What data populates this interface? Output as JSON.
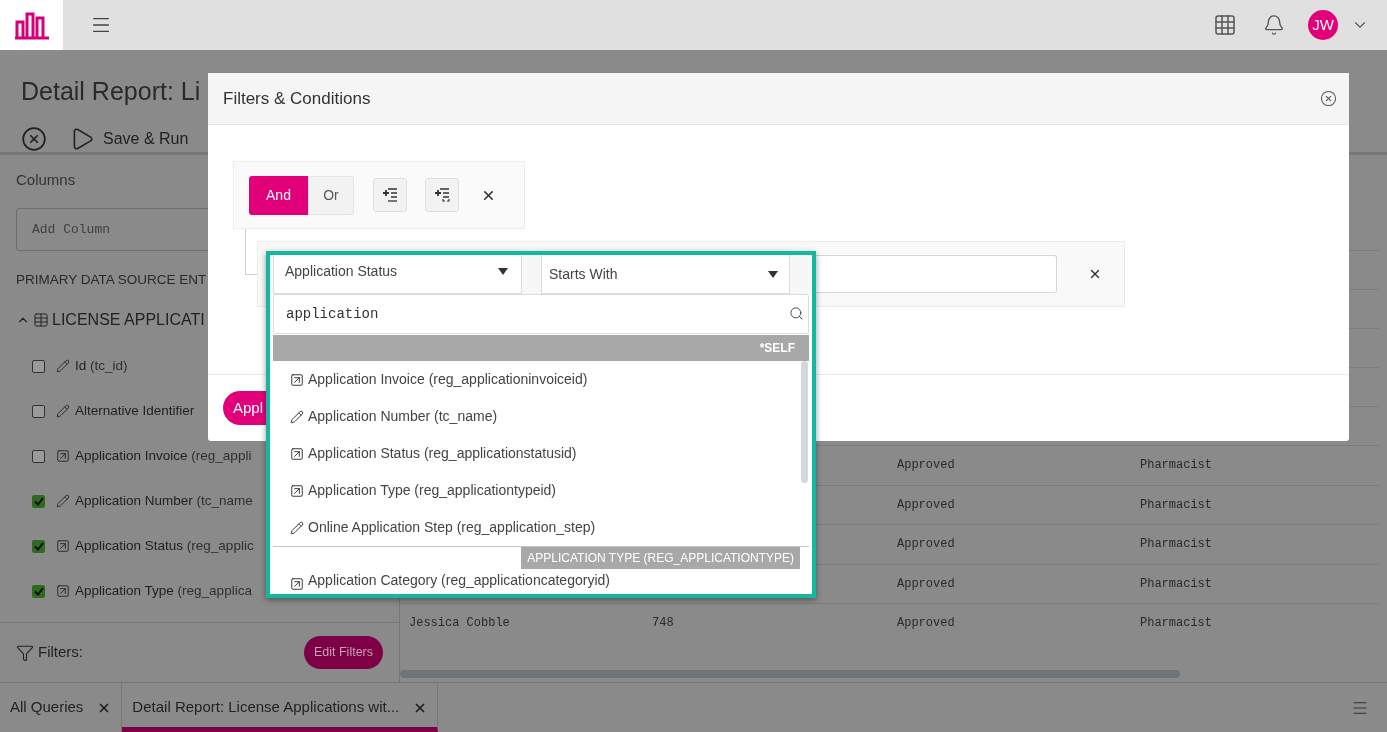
{
  "top_bar": {
    "avatar_initials": "JW"
  },
  "page": {
    "title": "Detail Report: Li",
    "run_label": "Save & Run"
  },
  "columns_panel": {
    "heading": "Columns",
    "add_column": {
      "placeholder": "Add Column"
    },
    "section_label": "PRIMARY DATA SOURCE ENT",
    "entity": {
      "label": "LICENSE APPLICATI",
      "expanded": true
    },
    "fields": [
      {
        "kind": "edit",
        "name": "Id",
        "attr": "(tc_id)",
        "checked": false
      },
      {
        "kind": "edit",
        "name": "Alternative Identifier",
        "checked": false
      },
      {
        "kind": "link",
        "name": "Application Invoice",
        "attr": "(reg_appli",
        "checked": false
      },
      {
        "kind": "edit",
        "name": "Application Number",
        "attr": "(tc_name",
        "checked": true
      },
      {
        "kind": "link",
        "name": "Application Status",
        "attr": "(reg_applic",
        "checked": true
      },
      {
        "kind": "link",
        "name": "Application Type",
        "attr": "(reg_applica",
        "checked": true
      }
    ]
  },
  "filters_bar": {
    "label": "Filters:",
    "button": "Edit Filters"
  },
  "table": {
    "rows": [
      {
        "status": "Approved",
        "role": "Pharmacist"
      },
      {
        "status": "Approved",
        "role": "Pharmacist"
      },
      {
        "status": "Approved",
        "role": "Pharmacist"
      },
      {
        "status": "Approved",
        "role": "Pharmacist"
      },
      {
        "name": "Jessica Cobble",
        "number": "748",
        "status": "Approved",
        "role": "Pharmacist"
      }
    ]
  },
  "bottom_tabs": [
    {
      "label": "All Queries",
      "selected": false
    },
    {
      "label": "Detail Report: License Applications wit...",
      "selected": true
    }
  ],
  "dialog": {
    "title": "Filters & Conditions",
    "operators": [
      {
        "label": "And",
        "selected": true
      },
      {
        "label": "Or",
        "selected": false
      }
    ],
    "condition": {
      "field": "Application Status",
      "operator": "Starts With"
    },
    "apply_label": "Appl"
  },
  "field_picker": {
    "search_value": "application",
    "groups": [
      {
        "header": "*SELF",
        "items": [
          {
            "kind": "link",
            "label": "Application Invoice (reg_applicationinvoiceid)"
          },
          {
            "kind": "edit",
            "label": "Application Number (tc_name)"
          },
          {
            "kind": "link",
            "label": "Application Status (reg_applicationstatusid)"
          },
          {
            "kind": "link",
            "label": "Application Type (reg_applicationtypeid)"
          },
          {
            "kind": "edit",
            "label": "Online Application Step (reg_application_step)"
          }
        ]
      },
      {
        "header": "APPLICATION TYPE (REG_APPLICATIONTYPE)",
        "items": [
          {
            "kind": "link",
            "label": "Application Category (reg_applicationcategoryid)"
          }
        ]
      }
    ]
  }
}
